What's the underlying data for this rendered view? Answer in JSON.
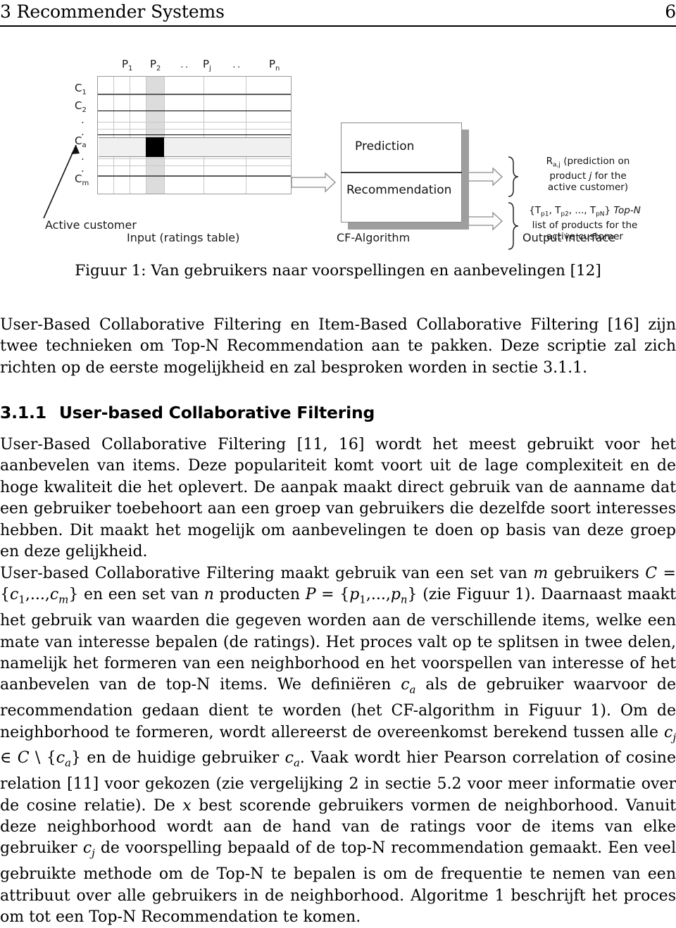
{
  "running_header": {
    "title": "3 Recommender Systems",
    "page_number": "6"
  },
  "figure": {
    "column_headers": [
      "P",
      "P",
      "..",
      "P",
      "..",
      "P"
    ],
    "column_header_subs": [
      "1",
      "2",
      "",
      "j",
      "",
      "n"
    ],
    "row_labels": [
      "C",
      "C",
      ".",
      ".",
      "C",
      ".",
      ".",
      "C"
    ],
    "row_label_subs": [
      "1",
      "2",
      "",
      "",
      "a",
      "",
      "",
      "m"
    ],
    "active_customer_label": "Active customer",
    "input_label": "Input (ratings table)",
    "cf_algorithm_label": "CF-Algorithm",
    "output_interface_label": "Output interface",
    "cf_box": {
      "top_label": "Prediction",
      "bottom_label": "Recommendation"
    },
    "output_top": {
      "line1_prefix": "R",
      "line1_sub": "a,j",
      "line1_rest": " (prediction on",
      "line2": "product j for the",
      "line3": "active customer)"
    },
    "output_bottom": {
      "line1": "{T p1, T p2, ..., T pN} Top-N",
      "line2": "list of products for the",
      "line3": "active customer"
    }
  },
  "figure_caption": "Figuur 1: Van gebruikers naar voorspellingen en aanbevelingen [12]",
  "paragraphs": {
    "intro": "User-Based Collaborative Filtering en Item-Based Collaborative Filtering [16] zijn twee technieken om Top-N Recommendation aan te pakken. Deze scriptie zal zich richten op de eerste mogelijkheid en zal besproken worden in sectie 3.1.1.",
    "ubcf_1": "User-Based Collaborative Filtering [11, 16] wordt het meest gebruikt voor het aanbevelen van items. Deze populariteit komt voort uit de lage complexiteit en de hoge kwaliteit die het oplevert. De aanpak maakt direct gebruik van de aanname dat een gebruiker toebehoort aan een groep van gebruikers die dezelfde soort interesses hebben. Dit maakt het mogelijk om aanbevelingen te doen op basis van deze groep en deze gelijkheid."
  },
  "section": {
    "number": "3.1.1",
    "title": "User-based Collaborative Filtering"
  },
  "paragraph_3": {
    "seg1": "User-based Collaborative Filtering maakt gebruik van een set van ",
    "m": "m",
    "seg2": " gebruikers ",
    "C": "C",
    "eq1": " = ",
    "set_c": "{c1,..., cm}",
    "seg3": " en een set van ",
    "n": "n",
    "seg4": " producten ",
    "P": "P",
    "eq2": " = ",
    "set_p": "{p1,..., pn}",
    "seg5": " (zie Figuur 1). Daarnaast maakt het gebruik van waarden die gegeven worden aan de verschillende items, welke een mate van interesse bepalen (de ratings). Het proces valt op te splitsen in twee delen, namelijk het formeren van een neighborhood en het voorspellen van interesse of het aanbevelen van de top-N items. We definiëren ",
    "ca": "ca",
    "seg6": " als de gebruiker waarvoor de recommendation gedaan dient te worden (het CF-algorithm in Figuur 1). Om de neighborhood te formeren, wordt allereerst de overeenkomst berekend tussen alle ",
    "cj": "cj",
    "seg7": " ∈ ",
    "Cset": "C",
    "seg8": " \\ ",
    "ca_set": "{ca}",
    "seg9": " en de huidige gebruiker ",
    "ca2": "ca",
    "seg10": ". Vaak wordt hier Pearson correlation of cosine relation [11] voor gekozen (zie vergelijking 2 in sectie 5.2 voor meer informatie over de cosine relatie). De ",
    "x": "x",
    "seg11": " best scorende gebruikers vormen de neighborhood. Vanuit deze neighborhood wordt aan de hand van de ratings voor de items van elke gebruiker ",
    "cj2": "cj",
    "seg12": " de voorspelling bepaald of de top-N recommendation gemaakt. Een veel gebruikte methode om de Top-N te bepalen is om de frequentie te nemen van een attribuut over alle gebruikers in de neighborhood. Algoritme 1 beschrijft het proces om tot een Top-N Recommendation te komen."
  }
}
